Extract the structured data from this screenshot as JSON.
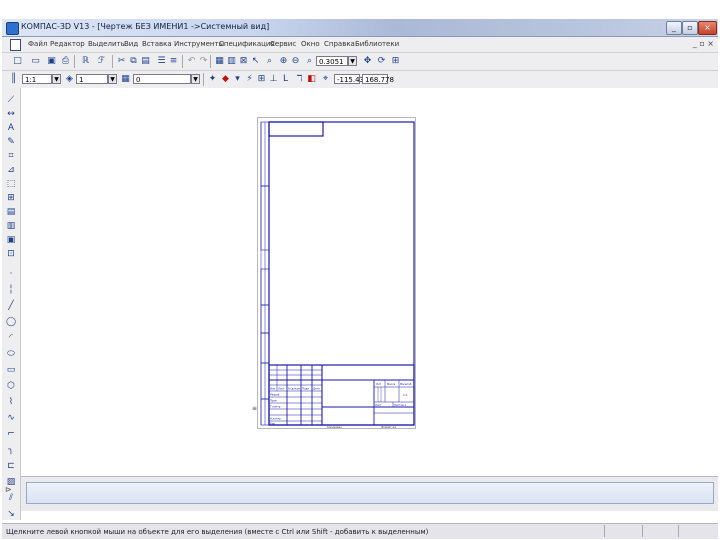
{
  "window": {
    "title": "КОМПАС-3D V13 - [Чертеж БЕЗ ИМЕНИ1 ->Системный вид]",
    "controls": [
      "_",
      "▫",
      "×"
    ]
  },
  "menu": {
    "items": [
      "Файл",
      "Редактор",
      "Выделить",
      "Вид",
      "Вставка",
      "Инструменты",
      "Спецификация",
      "Сервис",
      "Окно",
      "Справка",
      "Библиотеки"
    ],
    "mdi_controls": "_ ▫ ×"
  },
  "toolbar1": {
    "zoom_value": "0.3051"
  },
  "toolbar2": {
    "style_value": "1:1",
    "layer_value": "1",
    "view_value": "0",
    "coord_x": "-115.43",
    "coord_y": "168.778"
  },
  "drawing": {
    "stamp_izm": "Изм",
    "stamp_list": "Лист",
    "stamp_ndokum": "№ докум",
    "stamp_podp": "Подп",
    "stamp_data": "Дата",
    "stamp_razrab": "Разраб",
    "stamp_prov": "Пров",
    "stamp_tkontr": "Т.контр",
    "stamp_nkontr": "Н.контр",
    "stamp_utv": "Утв",
    "stamp_lit": "Лит",
    "stamp_massa": "Масса",
    "stamp_masshtab": "Масштаб",
    "stamp_scale": "1:1",
    "stamp_list2": "Лист",
    "stamp_listov": "Листов 1",
    "copied": "Копировал",
    "format": "Формат A4"
  },
  "status": {
    "message": "Щелкните левой кнопкой мыши на объекте для его выделения (вместе с Ctrl или Shift - добавить к выделенным)"
  }
}
